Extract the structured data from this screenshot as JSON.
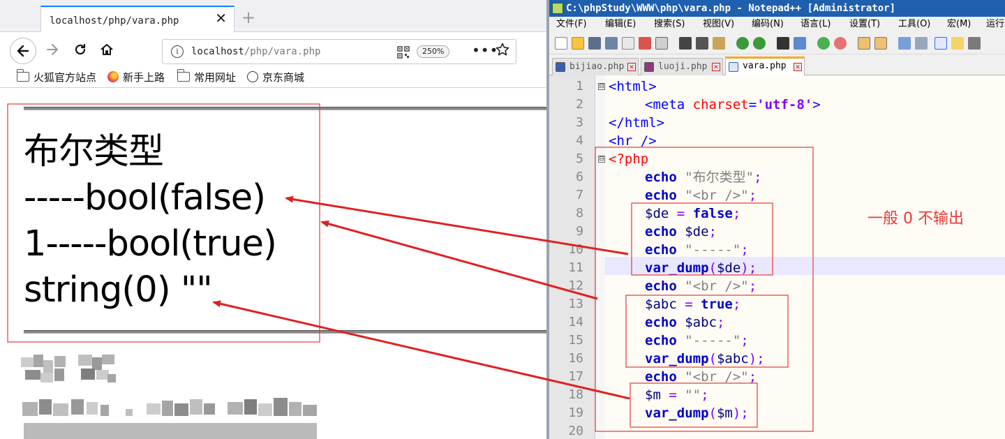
{
  "browser": {
    "tab_title": "localhost/php/vara.php",
    "tab_close_glyph": "✕",
    "new_tab_glyph": "+",
    "url_host": "localhost",
    "url_path": "/php/vara.php",
    "zoom": "250%",
    "more_glyph": "•••",
    "bookmarks": [
      {
        "label": "火狐官方站点",
        "icon": "folder-icon"
      },
      {
        "label": "新手上路",
        "icon": "firefox-icon"
      },
      {
        "label": "常用网址",
        "icon": "folder-icon"
      },
      {
        "label": "京东商城",
        "icon": "globe-icon"
      }
    ],
    "page_output": [
      "布尔类型",
      "-----bool(false)",
      "1-----bool(true)",
      "string(0) \"\""
    ]
  },
  "notepad": {
    "title": "C:\\phpStudy\\WWW\\php\\vara.php - Notepad++ [Administrator]",
    "menu": [
      "文件(F)",
      "编辑(E)",
      "搜索(S)",
      "视图(V)",
      "编码(N)",
      "语言(L)",
      "设置(T)",
      "工具(O)",
      "宏(M)",
      "运行"
    ],
    "tabs": [
      {
        "label": "bijiao.php",
        "active": false
      },
      {
        "label": "luoji.php",
        "active": false
      },
      {
        "label": "vara.php",
        "active": true
      }
    ],
    "line_numbers": [
      "1",
      "2",
      "3",
      "4",
      "5",
      "6",
      "7",
      "8",
      "9",
      "10",
      "11",
      "12",
      "13",
      "14",
      "15",
      "16",
      "17",
      "18",
      "19",
      "20"
    ],
    "code": {
      "l1": [
        "<html>"
      ],
      "l2": [
        "<meta",
        " charset",
        "=",
        "'utf-8'",
        ">"
      ],
      "l3": [
        "</html>"
      ],
      "l4": [
        "<hr />"
      ],
      "l5": [
        "<?php"
      ],
      "l6": [
        "echo",
        " \"布尔类型\"",
        ";"
      ],
      "l7": [
        "echo",
        " \"<br />\"",
        ";"
      ],
      "l8": [
        "$de",
        " = ",
        "false",
        ";"
      ],
      "l9": [
        "echo",
        " $de",
        ";"
      ],
      "l10": [
        "echo",
        " \"-----\"",
        ";"
      ],
      "l11": [
        "var_dump",
        "(",
        "$de",
        ");"
      ],
      "l12": [
        "echo",
        " \"<br />\"",
        ";"
      ],
      "l13": [
        "$abc",
        " = ",
        "true",
        ";"
      ],
      "l14": [
        "echo",
        " $abc",
        ";"
      ],
      "l15": [
        "echo",
        " \"-----\"",
        ";"
      ],
      "l16": [
        "var_dump",
        "(",
        "$abc",
        ");"
      ],
      "l17": [
        "echo",
        " \"<br />\"",
        ";"
      ],
      "l18": [
        "$m",
        " = ",
        "\"\"",
        ";"
      ],
      "l19": [
        "var_dump",
        "(",
        "$m",
        ");"
      ]
    },
    "fold_glyph": "⊟"
  },
  "annotation": {
    "note": "一般 0 不输出",
    "color": "#e53935"
  },
  "colors": {
    "accent_tab": "#0a84ff",
    "npp_title_bg": "#1e5fae",
    "keyword": "#0000cc",
    "annotation_red": "#e53935"
  }
}
